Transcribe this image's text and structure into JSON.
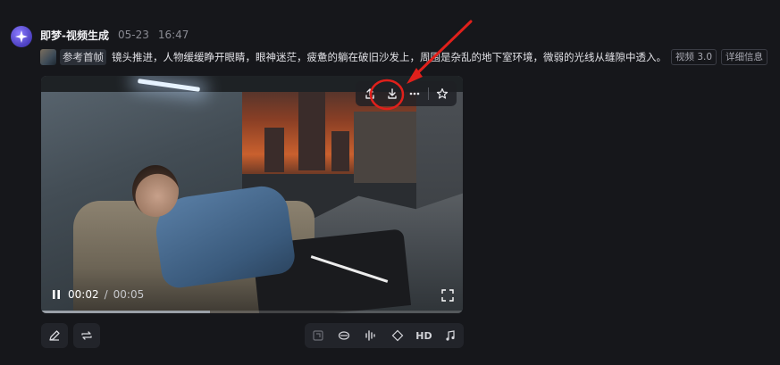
{
  "header": {
    "app_name": "即梦-视频生成",
    "date": "05-23",
    "time": "16:47"
  },
  "prompt": {
    "reference_label": "参考首帧",
    "text": "镜头推进，人物缓缓睁开眼睛，眼神迷茫，疲惫的躺在破旧沙发上，周围是杂乱的地下室环境，微弱的光线从缝隙中透入。",
    "badges": [
      "视频 3.0",
      "详细信息"
    ]
  },
  "video": {
    "current_time": "00:02",
    "separator": "/",
    "total_time": "00:05",
    "progress": 0.4,
    "overlay_icons": [
      "share-icon",
      "download-icon",
      "more-icon",
      "star-icon"
    ]
  },
  "bottom_toolbar": {
    "left_icons": [
      "edit-icon",
      "regenerate-icon"
    ],
    "right_icons": [
      "frame-icon",
      "lip-sync-icon",
      "audio-wave-icon",
      "diamond-icon",
      "hd-icon",
      "music-icon"
    ],
    "hd_label": "HD"
  },
  "annotation": {
    "color": "#e0201b"
  }
}
